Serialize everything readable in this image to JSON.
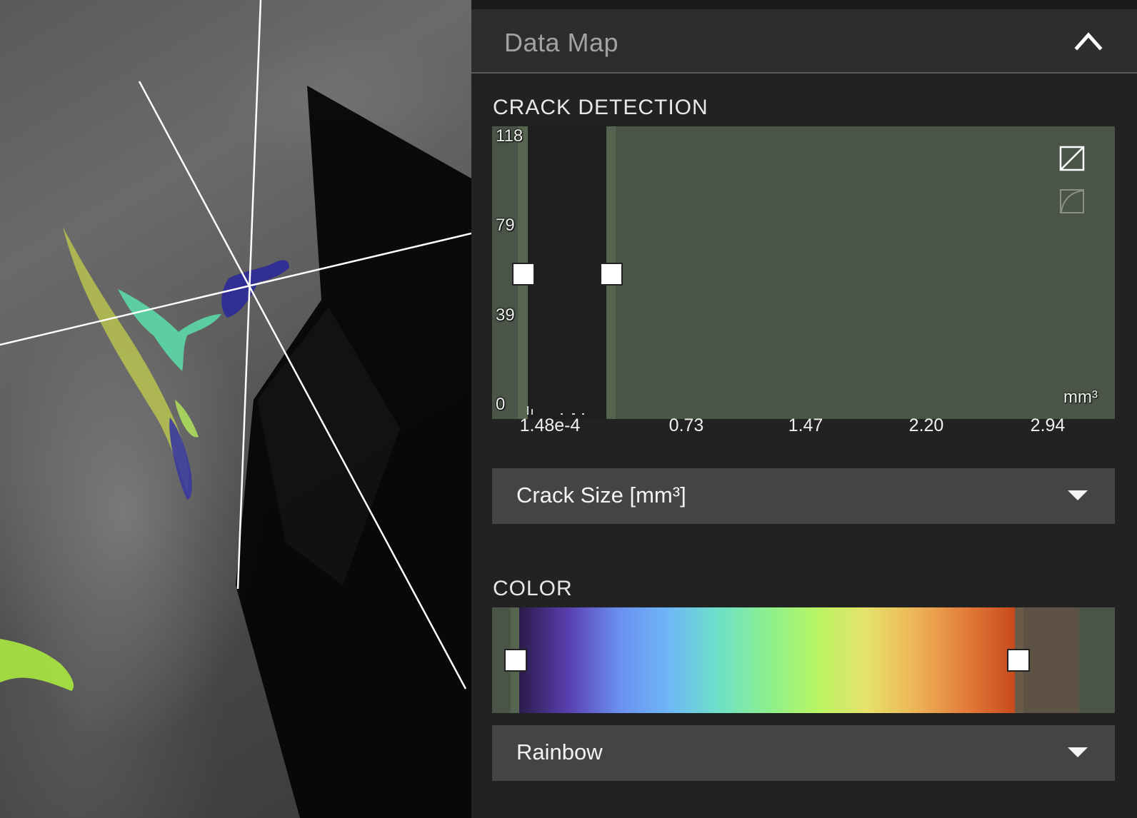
{
  "viewport": {
    "name": "3D crack visualization viewport"
  },
  "panel": {
    "title": "Data Map",
    "collapse_icon": "chevron-up-icon"
  },
  "crack_detection": {
    "label": "CRACK DETECTION",
    "histogram": {
      "y_ticks": [
        "118",
        "79",
        "39",
        "0"
      ],
      "x_ticks": [
        "1.48e-4",
        "0.73",
        "1.47",
        "2.20",
        "2.94"
      ],
      "unit": "mm³",
      "ylim": [
        0,
        118
      ],
      "xlim": [
        0.000148,
        2.94
      ],
      "icons": [
        "linear-scale-icon",
        "log-scale-icon"
      ]
    },
    "attribute_dropdown": {
      "selected": "Crack Size [mm³]"
    }
  },
  "color": {
    "label": "COLOR",
    "colormap_dropdown": {
      "selected": "Rainbow"
    },
    "gradient_stops": [
      "#2b1b4a",
      "#5a3fb0",
      "#6a8ff0",
      "#6fb6f7",
      "#6de0c9",
      "#8cef8f",
      "#b8f564",
      "#e6e26a",
      "#ecb457",
      "#e47d3a",
      "#c84a1e"
    ]
  },
  "colors": {
    "panel_bg": "#222222",
    "header_bg": "#2d2d2d",
    "range_green": "#4a5548",
    "dropdown_bg": "#444444",
    "handle": "#ffffff"
  }
}
